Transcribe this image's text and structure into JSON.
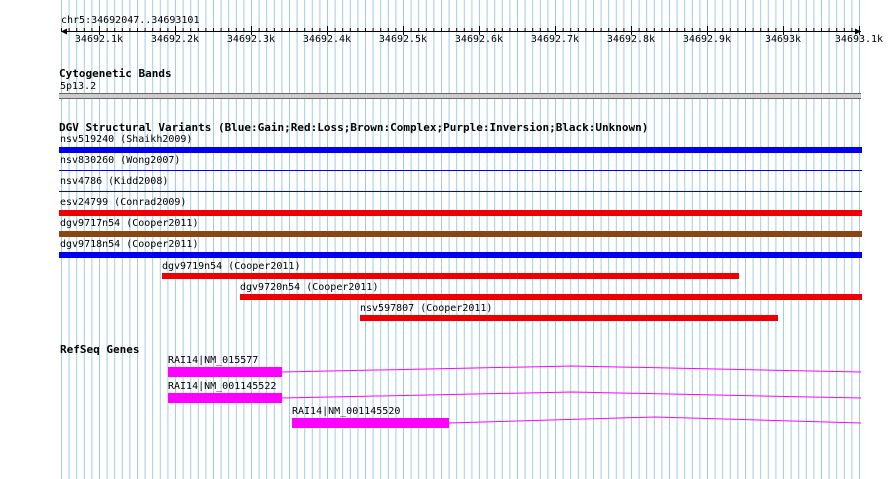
{
  "ruler": {
    "position_label": "chr5:34692047..34693101",
    "ticks": [
      {
        "label": "34692.1k"
      },
      {
        "label": "34692.2k"
      },
      {
        "label": "34692.3k"
      },
      {
        "label": "34692.4k"
      },
      {
        "label": "34692.5k"
      },
      {
        "label": "34692.6k"
      },
      {
        "label": "34692.7k"
      },
      {
        "label": "34692.8k"
      },
      {
        "label": "34692.9k"
      },
      {
        "label": "34693k"
      },
      {
        "label": "34693.1k"
      }
    ]
  },
  "cytobands": {
    "title": "Cytogenetic Bands",
    "band": "5p13.2"
  },
  "dgv": {
    "title": "DGV Structural Variants (Blue:Gain;Red:Loss;Brown:Complex;Purple:Inversion;Black:Unknown)",
    "colors": {
      "gain": "#0000ee",
      "loss": "#ee0000",
      "complex": "#8b4513"
    },
    "variants": [
      {
        "label": "nsv519240 (Shaikh2009)",
        "type": "gain"
      },
      {
        "label": "nsv830260 (Wong2007)",
        "type": "gain"
      },
      {
        "label": "nsv4786 (Kidd2008)",
        "type": "gain"
      },
      {
        "label": "esv24799 (Conrad2009)",
        "type": "loss"
      },
      {
        "label": "dgv9717n54 (Cooper2011)",
        "type": "complex"
      },
      {
        "label": "dgv9718n54 (Cooper2011)",
        "type": "gain"
      },
      {
        "label": "dgv9719n54 (Cooper2011)",
        "type": "loss"
      },
      {
        "label": "dgv9720n54 (Cooper2011)",
        "type": "loss"
      },
      {
        "label": "nsv597807 (Cooper2011)",
        "type": "loss"
      }
    ]
  },
  "refseq": {
    "title": "RefSeq Genes",
    "color": "#ff00ff",
    "genes": [
      {
        "label": "RAI14|NM_015577"
      },
      {
        "label": "RAI14|NM_001145522"
      },
      {
        "label": "RAI14|NM_001145520"
      }
    ]
  }
}
